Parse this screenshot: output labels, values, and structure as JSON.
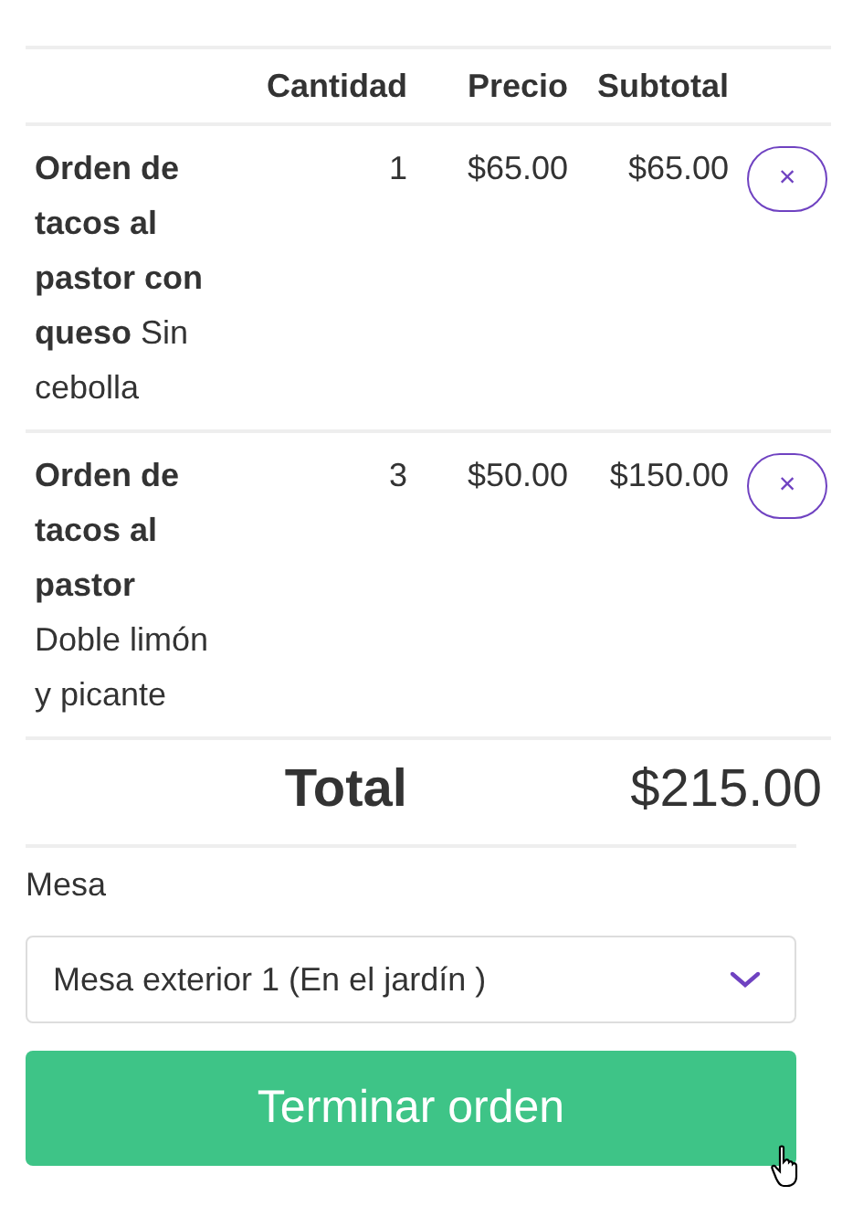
{
  "table": {
    "columns": [
      "",
      "Cantidad",
      "Precio",
      "Subtotal"
    ],
    "rows": [
      {
        "name": "Orden de tacos al pastor con queso",
        "note": "Sin cebolla",
        "quantity": "1",
        "price": "$65.00",
        "subtotal": "$65.00",
        "remove": "×"
      },
      {
        "name": "Orden de tacos al pastor",
        "note": "Doble limón y picante",
        "quantity": "3",
        "price": "$50.00",
        "subtotal": "$150.00",
        "remove": "×"
      }
    ],
    "total_label": "Total",
    "total": "$215.00"
  },
  "table_field": {
    "label": "Mesa",
    "value": "Mesa exterior 1 (En el jardín )"
  },
  "submit": "Terminar orden"
}
